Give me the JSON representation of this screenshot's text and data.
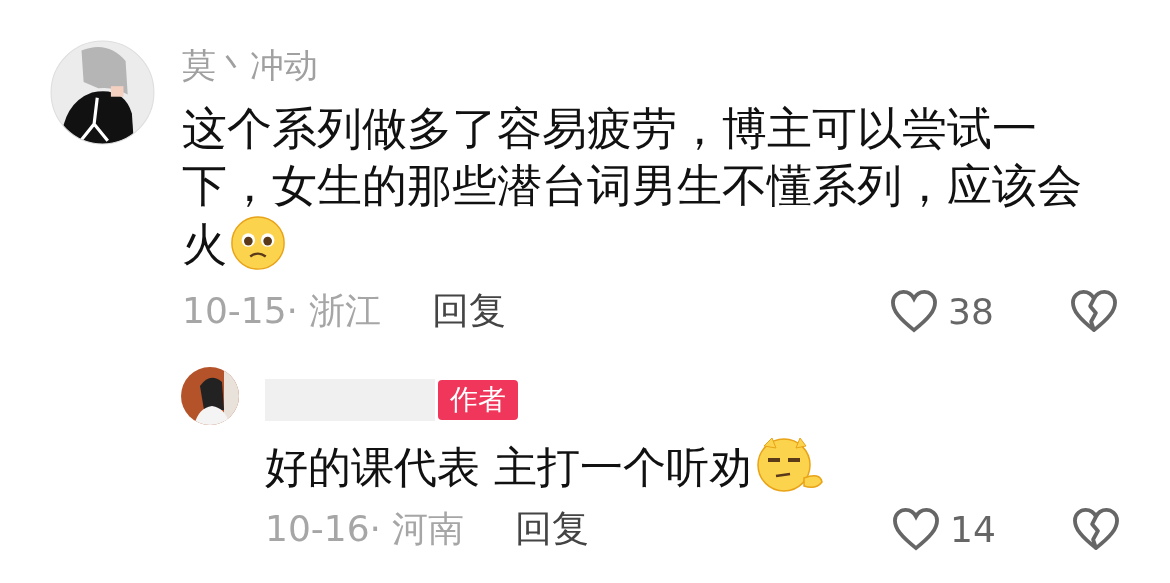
{
  "comments": [
    {
      "username": "莫丶冲动",
      "text": "这个系列做多了容易疲劳，博主可以尝试一下，女生的那些潜台词男生不懂系列，应该会火",
      "emoji": {
        "kind": "pleading"
      },
      "date_location": "10-15· 浙江",
      "reply_label": "回复",
      "likes": "38",
      "replies": [
        {
          "name_hidden": true,
          "badge": "作者",
          "text": "好的课代表 主打一个听劝",
          "emoji": {
            "kind": "sideeye"
          },
          "date_location": "10-16· 河南",
          "reply_label": "回复",
          "likes": "14"
        }
      ]
    }
  ]
}
